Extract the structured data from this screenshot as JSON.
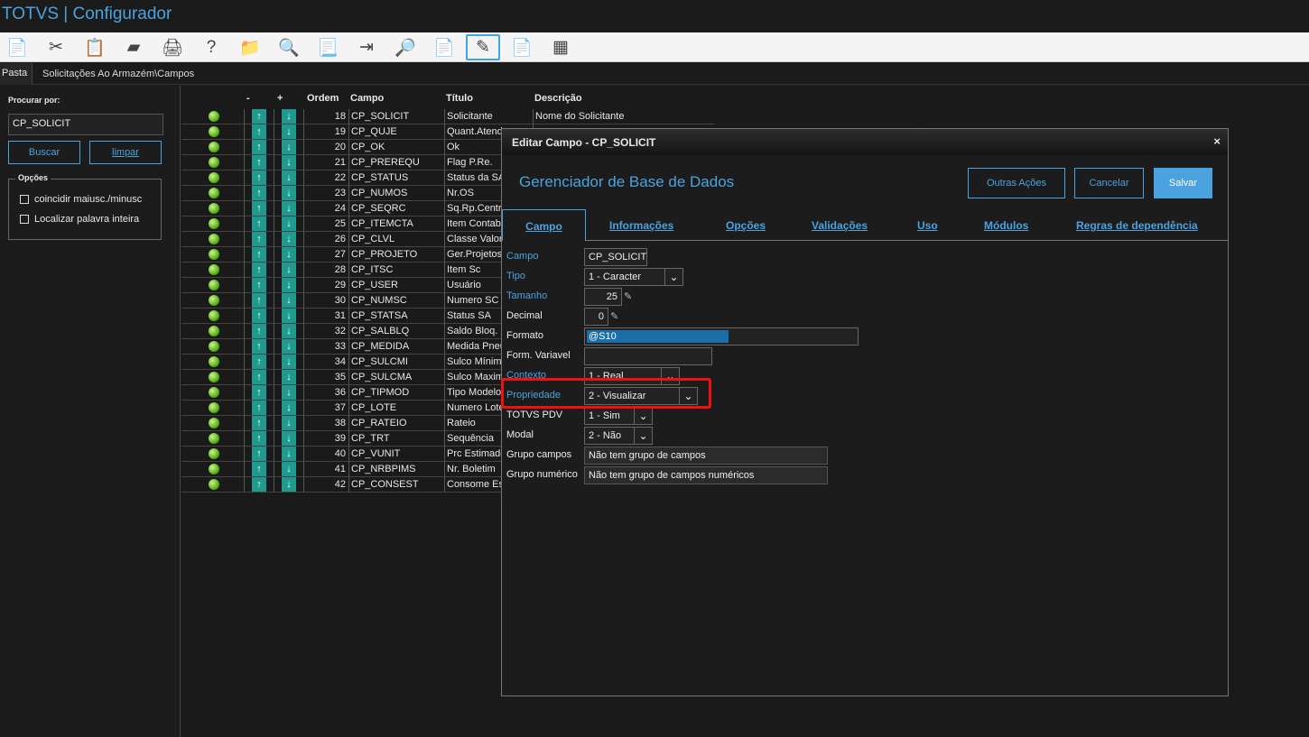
{
  "app": {
    "title": "TOTVS | Configurador"
  },
  "toolbar": {
    "buttons": [
      {
        "icon": "copy-icon",
        "glyph": "📄"
      },
      {
        "icon": "cut-icon",
        "glyph": "✂"
      },
      {
        "icon": "paste-icon",
        "glyph": "📋"
      },
      {
        "icon": "eraser-icon",
        "glyph": "▰"
      },
      {
        "icon": "print-icon",
        "glyph": "🖨"
      },
      {
        "icon": "help-icon",
        "glyph": "?"
      },
      {
        "icon": "folder-icon",
        "glyph": "📁"
      },
      {
        "icon": "search-icon",
        "glyph": "🔍"
      },
      {
        "icon": "document-delete-icon",
        "glyph": "📃"
      },
      {
        "icon": "exit-icon",
        "glyph": "⇥"
      },
      {
        "icon": "preview-icon",
        "glyph": "🔎"
      },
      {
        "icon": "document-add-icon",
        "glyph": "📄"
      },
      {
        "icon": "edit-icon",
        "glyph": "✎"
      },
      {
        "icon": "document-remove-icon",
        "glyph": "📄"
      },
      {
        "icon": "table-icon",
        "glyph": "▦"
      }
    ]
  },
  "pathbar": {
    "tab": "Pasta",
    "path": "Solicitações Ao Armazém\\Campos"
  },
  "search": {
    "label": "Procurar por:",
    "value": "CP_SOLICIT",
    "search_button": "Buscar",
    "clear_button": "limpar",
    "options_legend": "Opções",
    "option_case": "coincidir maiusc./minusc",
    "option_word": "Localizar palavra inteira"
  },
  "grid": {
    "headers": {
      "minus": "-",
      "plus": "+",
      "ordem": "Ordem",
      "campo": "Campo",
      "titulo": "Título",
      "descricao": "Descrição"
    },
    "up_arrow": "↑",
    "down_arrow": "↓",
    "rows": [
      {
        "ordem": "18",
        "campo": "CP_SOLICIT",
        "titulo": "Solicitante",
        "descricao": "Nome do Solicitante"
      },
      {
        "ordem": "19",
        "campo": "CP_QUJE",
        "titulo": "Quant.Atend",
        "descricao": ""
      },
      {
        "ordem": "20",
        "campo": "CP_OK",
        "titulo": "Ok",
        "descricao": ""
      },
      {
        "ordem": "21",
        "campo": "CP_PREREQU",
        "titulo": "Flag P.Re.",
        "descricao": ""
      },
      {
        "ordem": "22",
        "campo": "CP_STATUS",
        "titulo": "Status da SA",
        "descricao": ""
      },
      {
        "ordem": "23",
        "campo": "CP_NUMOS",
        "titulo": "Nr.OS",
        "descricao": ""
      },
      {
        "ordem": "24",
        "campo": "CP_SEQRC",
        "titulo": "Sq.Rp.Centr",
        "descricao": ""
      },
      {
        "ordem": "25",
        "campo": "CP_ITEMCTA",
        "titulo": "Item Contab",
        "descricao": ""
      },
      {
        "ordem": "26",
        "campo": "CP_CLVL",
        "titulo": "Classe Valor",
        "descricao": ""
      },
      {
        "ordem": "27",
        "campo": "CP_PROJETO",
        "titulo": "Ger.Projetos",
        "descricao": ""
      },
      {
        "ordem": "28",
        "campo": "CP_ITSC",
        "titulo": "Item Sc",
        "descricao": ""
      },
      {
        "ordem": "29",
        "campo": "CP_USER",
        "titulo": "Usuário",
        "descricao": ""
      },
      {
        "ordem": "30",
        "campo": "CP_NUMSC",
        "titulo": "Numero SC",
        "descricao": ""
      },
      {
        "ordem": "31",
        "campo": "CP_STATSA",
        "titulo": "Status SA",
        "descricao": ""
      },
      {
        "ordem": "32",
        "campo": "CP_SALBLQ",
        "titulo": "Saldo Bloq.",
        "descricao": ""
      },
      {
        "ordem": "33",
        "campo": "CP_MEDIDA",
        "titulo": "Medida Pneu",
        "descricao": ""
      },
      {
        "ordem": "34",
        "campo": "CP_SULCMI",
        "titulo": "Sulco Mínimo",
        "descricao": ""
      },
      {
        "ordem": "35",
        "campo": "CP_SULCMA",
        "titulo": "Sulco Maximo",
        "descricao": ""
      },
      {
        "ordem": "36",
        "campo": "CP_TIPMOD",
        "titulo": "Tipo Modelo",
        "descricao": ""
      },
      {
        "ordem": "37",
        "campo": "CP_LOTE",
        "titulo": "Numero Lote",
        "descricao": ""
      },
      {
        "ordem": "38",
        "campo": "CP_RATEIO",
        "titulo": "Rateio",
        "descricao": ""
      },
      {
        "ordem": "39",
        "campo": "CP_TRT",
        "titulo": "Sequência",
        "descricao": ""
      },
      {
        "ordem": "40",
        "campo": "CP_VUNIT",
        "titulo": "Prc Estimado",
        "descricao": ""
      },
      {
        "ordem": "41",
        "campo": "CP_NRBPIMS",
        "titulo": "Nr. Boletim",
        "descricao": ""
      },
      {
        "ordem": "42",
        "campo": "CP_CONSEST",
        "titulo": "Consome Est",
        "descricao": ""
      }
    ]
  },
  "dialog": {
    "title": "Editar Campo - CP_SOLICIT",
    "close": "×",
    "heading": "Gerenciador de Base de Dados",
    "more_actions": "Outras Ações",
    "cancel": "Cancelar",
    "save": "Salvar",
    "tabs": [
      "Campo",
      "Informações",
      "Opções",
      "Validações",
      "Uso",
      "Módulos",
      "Regras de dependência"
    ],
    "fields": {
      "campo_label": "Campo",
      "campo_value": "CP_SOLICIT",
      "tipo_label": "Tipo",
      "tipo_value": "1 - Caracter",
      "tamanho_label": "Tamanho",
      "tamanho_value": "25",
      "decimal_label": "Decimal",
      "decimal_value": "0",
      "formato_label": "Formato",
      "formato_value": "@S10",
      "formvar_label": "Form. Variavel",
      "formvar_value": "",
      "contexto_label": "Contexto",
      "contexto_value": "1 - Real",
      "propriedade_label": "Propriedade",
      "propriedade_value": "2 - Visualizar",
      "pdv_label": "TOTVS PDV",
      "pdv_value": "1 - Sim",
      "modal_label": "Modal",
      "modal_value": "2 - Não",
      "grupo_label": "Grupo campos",
      "grupo_value": "Não tem grupo de campos",
      "grupo_num_label": "Grupo numérico",
      "grupo_num_value": "Não tem grupo de campos numéricos"
    }
  },
  "colors": {
    "accent": "#4aa3df",
    "highlight": "#ee1111",
    "arrow_bg": "#1f9a8f"
  }
}
